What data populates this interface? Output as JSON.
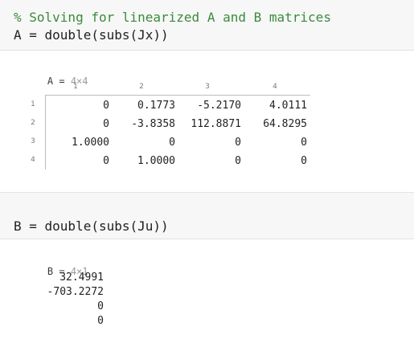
{
  "cell1": {
    "comment": "% Solving for linearized A and B matrices",
    "code": "A = double(subs(Jx))"
  },
  "outputA": {
    "name": "A",
    "eq": " = ",
    "size": "4×4",
    "col_headers": [
      "1",
      "2",
      "3",
      "4"
    ],
    "row_headers": [
      "1",
      "2",
      "3",
      "4"
    ],
    "rows": [
      [
        "0",
        "0.1773",
        "-5.2170",
        "4.0111"
      ],
      [
        "0",
        "-3.8358",
        "112.8871",
        "64.8295"
      ],
      [
        "1.0000",
        "0",
        "0",
        "0"
      ],
      [
        "0",
        "1.0000",
        "0",
        "0"
      ]
    ]
  },
  "cell2": {
    "code": "B = double(subs(Ju))"
  },
  "outputB": {
    "name": "B",
    "eq": " = ",
    "size": "4×1",
    "values": [
      "32.4991",
      "-703.2272",
      "0",
      "0"
    ]
  }
}
